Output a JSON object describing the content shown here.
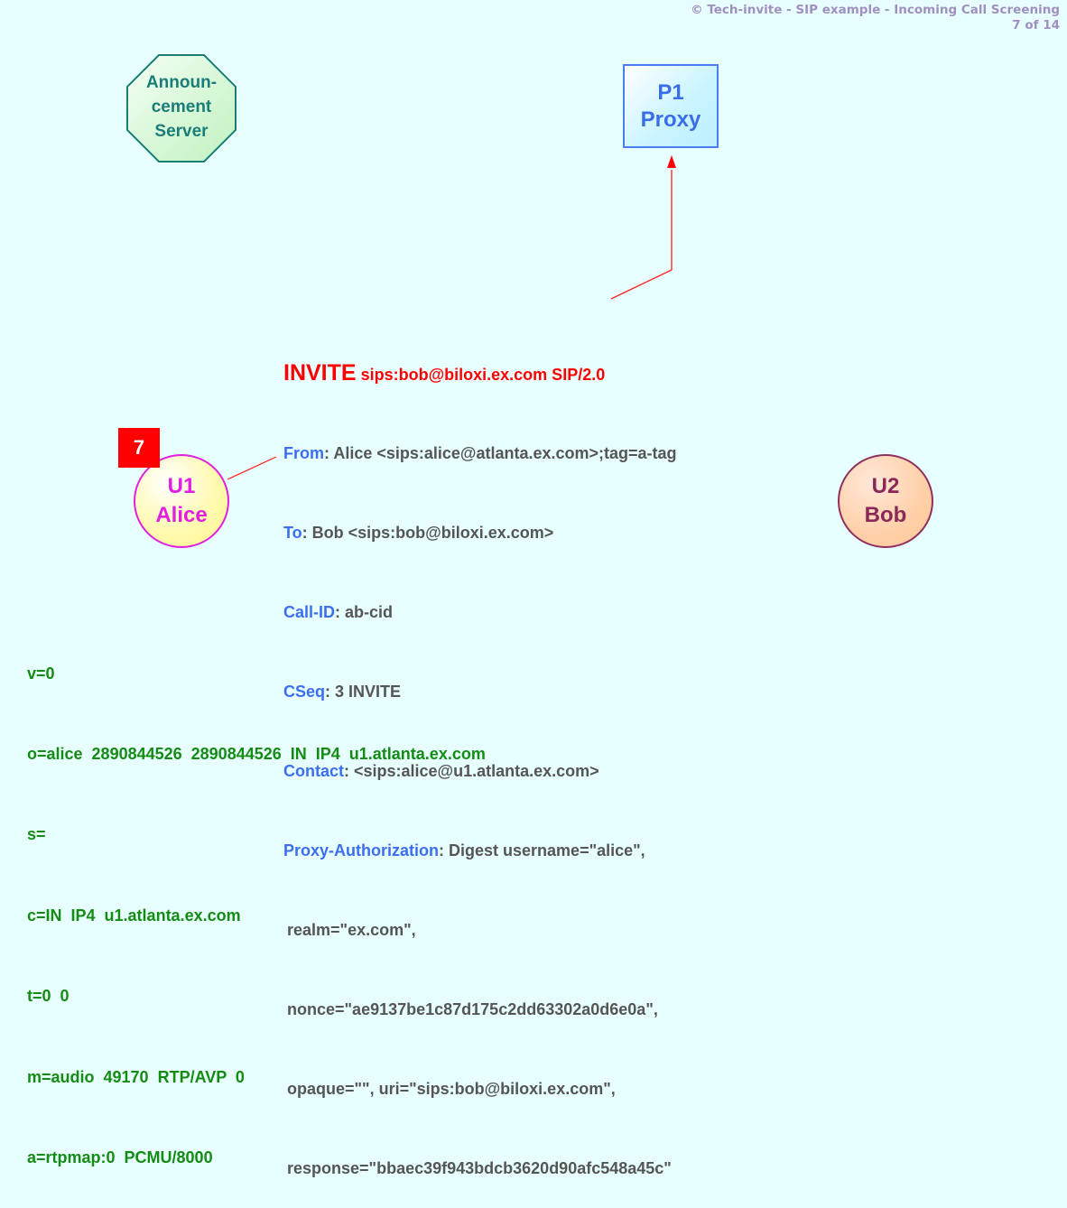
{
  "header": {
    "title": "© Tech-invite - SIP example - Incoming Call Screening",
    "page": "7 of 14"
  },
  "nodes": {
    "announcement_server": {
      "lines": [
        "Announ-",
        "cement",
        "Server"
      ]
    },
    "proxy": {
      "line1": "P1",
      "line2": "Proxy"
    },
    "alice": {
      "line1": "U1",
      "line2": "Alice"
    },
    "bob": {
      "line1": "U2",
      "line2": "Bob"
    }
  },
  "step": {
    "number": "7"
  },
  "message": {
    "method": "INVITE",
    "request_uri": "sips:bob@biloxi.ex.com SIP/2.0",
    "headers": [
      {
        "name": "From",
        "value": ": Alice <sips:alice@atlanta.ex.com>;tag=a-tag"
      },
      {
        "name": "To",
        "value": ": Bob <sips:bob@biloxi.ex.com>"
      },
      {
        "name": "Call-ID",
        "value": ": ab-cid"
      },
      {
        "name": "CSeq",
        "value": ": 3 INVITE"
      },
      {
        "name": "Contact",
        "value": ": <sips:alice@u1.atlanta.ex.com>"
      },
      {
        "name": "Proxy-Authorization",
        "value": ": Digest username=\"alice\","
      }
    ],
    "continuation": [
      "realm=\"ex.com\",",
      "nonce=\"ae9137be1c87d175c2dd63302a0d6e0a\",",
      "opaque=\"\", uri=\"sips:bob@biloxi.ex.com\",",
      "response=\"bbaec39f943bdcb3620d90afc548a45c\""
    ]
  },
  "sdp": [
    "v=0",
    "o=alice  2890844526  2890844526  IN  IP4  u1.atlanta.ex.com",
    "s=",
    "c=IN  IP4  u1.atlanta.ex.com",
    "t=0  0",
    "m=audio  49170  RTP/AVP  0",
    "a=rtpmap:0  PCMU/8000"
  ],
  "colors": {
    "background": "#e8ffff",
    "arrow": "#ff0000",
    "header_name": "#3c6ef0",
    "header_value": "#555555",
    "sdp": "#148c14"
  }
}
